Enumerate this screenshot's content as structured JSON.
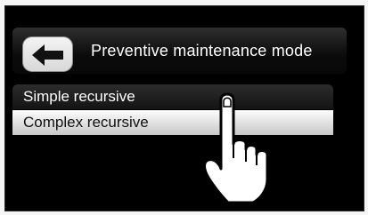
{
  "header": {
    "title": "Preventive maintenance mode",
    "back_icon": "left-arrow-icon"
  },
  "menu": {
    "items": [
      {
        "label": "Simple recursive",
        "state": "normal"
      },
      {
        "label": "Complex recursive",
        "state": "highlighted"
      }
    ]
  },
  "overlay": {
    "icon": "pointing-hand-icon"
  },
  "colors": {
    "screen_background": "#000000",
    "highlight_item": "#e6e6e6",
    "text_primary": "#ffffff"
  }
}
